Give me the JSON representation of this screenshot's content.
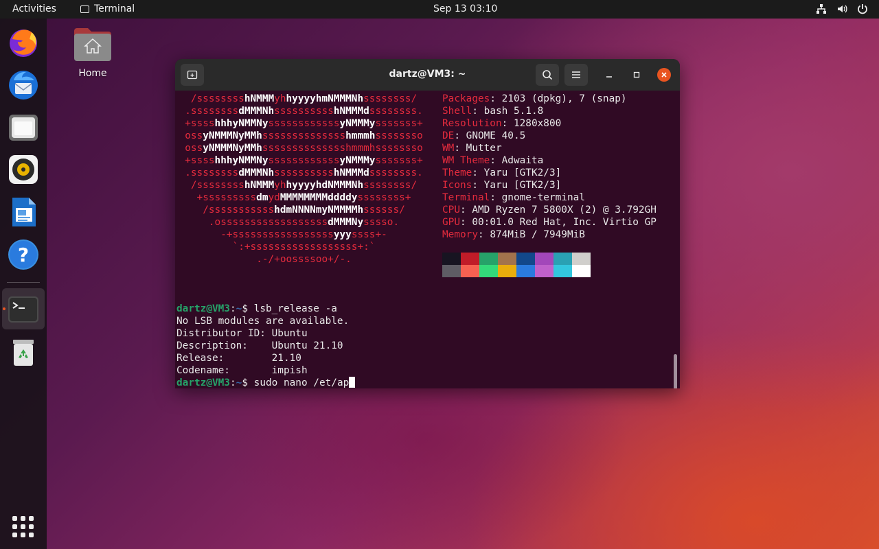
{
  "topbar": {
    "activities": "Activities",
    "app_name": "Terminal",
    "clock": "Sep 13  03:10",
    "tray_icons": [
      "network-icon",
      "volume-icon",
      "power-icon"
    ]
  },
  "dock": {
    "items": [
      {
        "name": "firefox-icon"
      },
      {
        "name": "thunderbird-icon"
      },
      {
        "name": "files-icon"
      },
      {
        "name": "rhythmbox-icon"
      },
      {
        "name": "libreoffice-writer-icon"
      },
      {
        "name": "help-icon"
      },
      {
        "name": "terminal-icon",
        "running": true
      },
      {
        "name": "trash-icon"
      }
    ],
    "show_apps": "show-applications-icon"
  },
  "desktop": {
    "home_label": "Home"
  },
  "terminal": {
    "title": "dartz@VM3: ~",
    "info": [
      {
        "key": "Packages",
        "value": "2103 (dpkg), 7 (snap)"
      },
      {
        "key": "Shell",
        "value": "bash 5.1.8"
      },
      {
        "key": "Resolution",
        "value": "1280x800"
      },
      {
        "key": "DE",
        "value": "GNOME 40.5"
      },
      {
        "key": "WM",
        "value": "Mutter"
      },
      {
        "key": "WM Theme",
        "value": "Adwaita"
      },
      {
        "key": "Theme",
        "value": "Yaru [GTK2/3]"
      },
      {
        "key": "Icons",
        "value": "Yaru [GTK2/3]"
      },
      {
        "key": "Terminal",
        "value": "gnome-terminal"
      },
      {
        "key": "CPU",
        "value": "AMD Ryzen 7 5800X (2) @ 3.792GH"
      },
      {
        "key": "GPU",
        "value": "00:01.0 Red Hat, Inc. Virtio GP"
      },
      {
        "key": "Memory",
        "value": "874MiB / 7949MiB"
      }
    ],
    "palette_top": [
      "#171421",
      "#c01c28",
      "#26a269",
      "#a2734c",
      "#12488b",
      "#a347ba",
      "#2aa1b3",
      "#d0cfcc"
    ],
    "palette_bottom": [
      "#5e5c64",
      "#f66151",
      "#33da7a",
      "#e9ad0c",
      "#2a7bde",
      "#c061cb",
      "#33c7de",
      "#ffffff"
    ],
    "prompt_user": "dartz@VM3",
    "prompt_path": "~",
    "cmd1": "lsb_release -a",
    "out1": "No LSB modules are available.",
    "out2": "Distributor ID:\tUbuntu",
    "out3": "Description:\tUbuntu 21.10",
    "out4": "Release:\t21.10",
    "out5": "Codename:\timpish",
    "cmd2": "sudo nano /et/ap"
  }
}
